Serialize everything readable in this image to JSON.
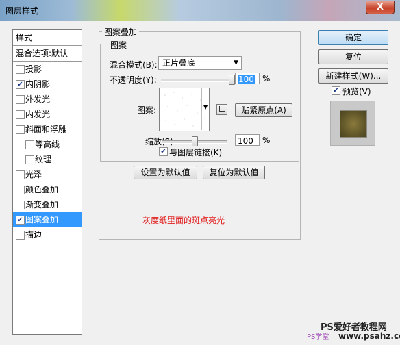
{
  "window": {
    "title": "图层样式",
    "close_label": "X"
  },
  "sidebar": {
    "header": "样式",
    "blend_options": "混合选项:默认",
    "items": [
      {
        "label": "投影",
        "checked": false,
        "sub": false
      },
      {
        "label": "内阴影",
        "checked": true,
        "sub": false
      },
      {
        "label": "外发光",
        "checked": false,
        "sub": false
      },
      {
        "label": "内发光",
        "checked": false,
        "sub": false
      },
      {
        "label": "斜面和浮雕",
        "checked": false,
        "sub": false
      },
      {
        "label": "等高线",
        "checked": false,
        "sub": true
      },
      {
        "label": "纹理",
        "checked": false,
        "sub": true
      },
      {
        "label": "光泽",
        "checked": false,
        "sub": false
      },
      {
        "label": "颜色叠加",
        "checked": false,
        "sub": false
      },
      {
        "label": "渐变叠加",
        "checked": false,
        "sub": false
      },
      {
        "label": "图案叠加",
        "checked": true,
        "sub": false,
        "active": true
      },
      {
        "label": "描边",
        "checked": false,
        "sub": false
      }
    ]
  },
  "panel": {
    "section_title": "图案叠加",
    "group_title": "图案",
    "blend_mode_label": "混合模式(B):",
    "blend_mode_value": "正片叠底",
    "opacity_label": "不透明度(Y):",
    "opacity_value": "100",
    "opacity_fraction": 1.0,
    "percent": "%",
    "pattern_label": "图案:",
    "snap_origin_label": "贴紧原点(A)",
    "scale_label": "缩放(S):",
    "scale_value": "100",
    "scale_fraction": 0.5,
    "link_label": "与图层链接(K)",
    "link_checked": true,
    "set_default_label": "设置为默认值",
    "reset_default_label": "复位为默认值",
    "annotation_text": "灰度纸里面的斑点亮光",
    "annotation_color": "#e11b1b"
  },
  "actions": {
    "ok_label": "确定",
    "reset_label": "复位",
    "new_style_label": "新建样式(W)...",
    "preview_label": "预览(V)",
    "preview_checked": true
  },
  "watermark": {
    "site_name": "PS爱好者教程网",
    "site_url": "www.psahz.com",
    "corner_text": "PS学堂"
  }
}
